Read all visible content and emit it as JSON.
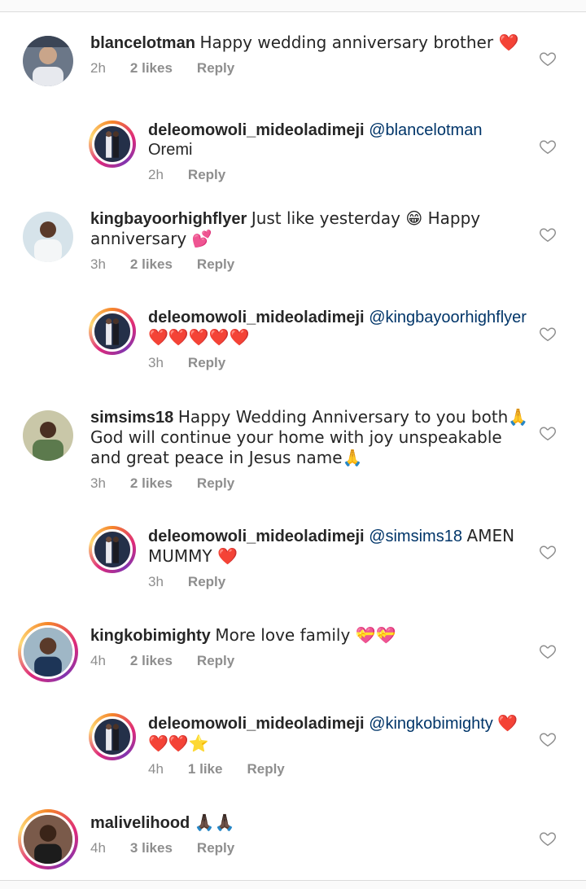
{
  "comments": [
    {
      "user": "blancelotman",
      "text": "Happy wedding anniversary brother ❤️",
      "time": "2h",
      "likes": "2 likes",
      "reply": "Reply"
    },
    {
      "user": "deleomowoli_mideoladimeji",
      "mention": "@blancelotman",
      "text": "Oremi",
      "time": "2h",
      "reply": "Reply"
    },
    {
      "user": "kingbayoorhighflyer",
      "text": "Just like yesterday 😁 Happy anniversary 💕",
      "time": "3h",
      "likes": "2 likes",
      "reply": "Reply"
    },
    {
      "user": "deleomowoli_mideoladimeji",
      "mention": "@kingbayoorhighflyer",
      "text": "❤️❤️❤️❤️❤️",
      "time": "3h",
      "reply": "Reply"
    },
    {
      "user": "simsims18",
      "text": "Happy Wedding Anniversary to you both🙏 God will continue your home with joy unspeakable and great peace in Jesus name🙏",
      "time": "3h",
      "likes": "2 likes",
      "reply": "Reply"
    },
    {
      "user": "deleomowoli_mideoladimeji",
      "mention": "@simsims18",
      "text": "AMEN MUMMY ❤️",
      "time": "3h",
      "reply": "Reply"
    },
    {
      "user": "kingkobimighty",
      "text": "More love family 💝💝",
      "time": "4h",
      "likes": "2 likes",
      "reply": "Reply"
    },
    {
      "user": "deleomowoli_mideoladimeji",
      "mention": "@kingkobimighty",
      "text": "❤️❤️❤️⭐",
      "time": "4h",
      "likes": "1 like",
      "reply": "Reply"
    },
    {
      "user": "malivelihood",
      "text": "🙏🏿🙏🏿",
      "time": "4h",
      "likes": "3 likes",
      "reply": "Reply"
    }
  ],
  "icons": {
    "like": "heart-outline-icon"
  },
  "colors": {
    "mention": "#003569",
    "meta": "#8e8e8e",
    "text": "#262626"
  }
}
